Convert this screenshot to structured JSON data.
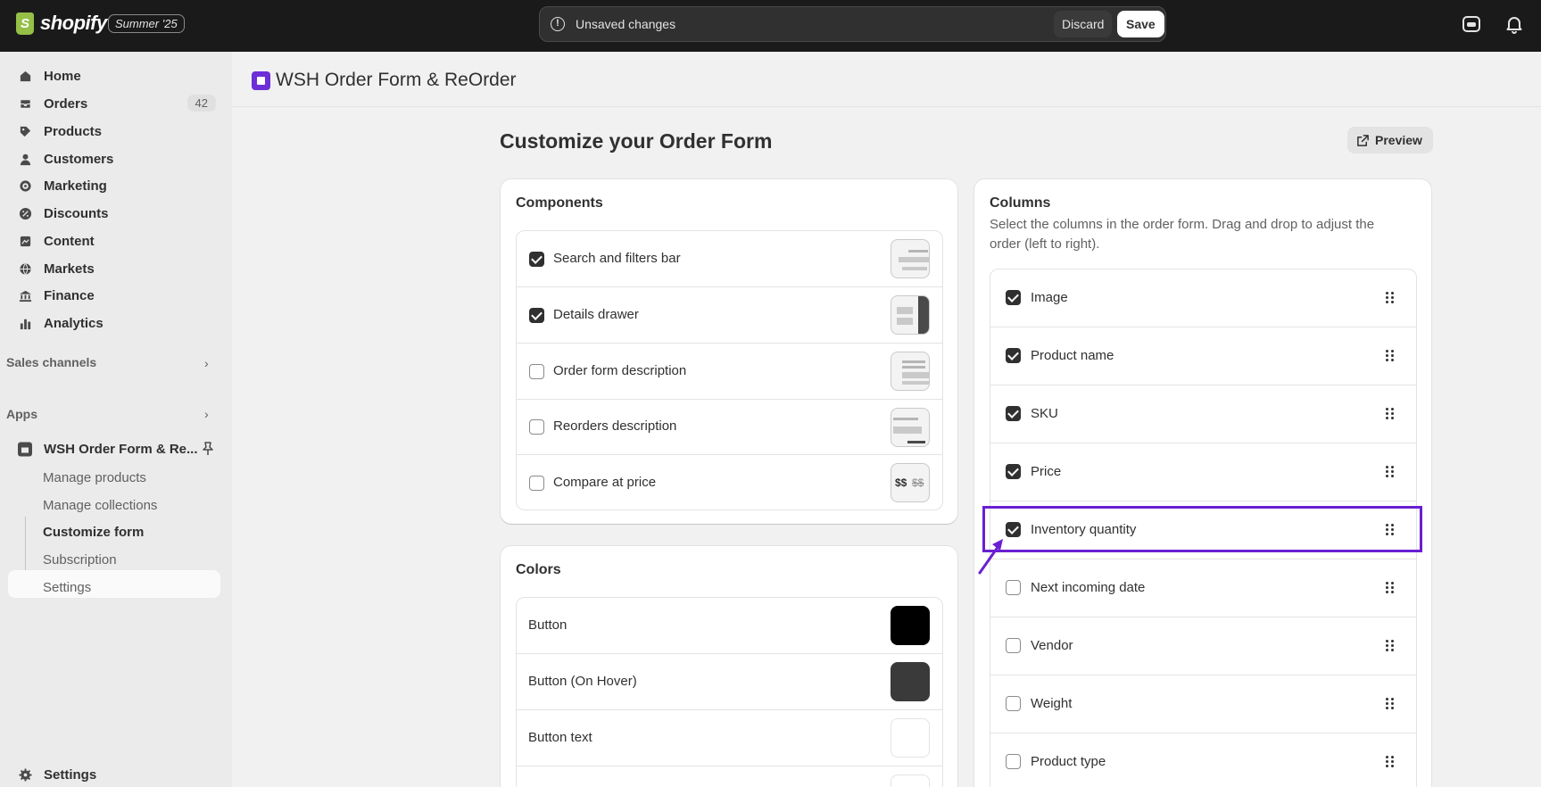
{
  "topbar": {
    "brand": "shopify",
    "edition": "Summer '25",
    "unsaved_message": "Unsaved changes",
    "discard_label": "Discard",
    "save_label": "Save"
  },
  "sidebar": {
    "items": [
      {
        "label": "Home",
        "icon": "home-icon"
      },
      {
        "label": "Orders",
        "icon": "orders-icon",
        "count": "42"
      },
      {
        "label": "Products",
        "icon": "tag-icon"
      },
      {
        "label": "Customers",
        "icon": "person-icon"
      },
      {
        "label": "Marketing",
        "icon": "target-icon"
      },
      {
        "label": "Discounts",
        "icon": "discount-icon"
      },
      {
        "label": "Content",
        "icon": "content-icon"
      },
      {
        "label": "Markets",
        "icon": "globe-icon"
      },
      {
        "label": "Finance",
        "icon": "bank-icon"
      },
      {
        "label": "Analytics",
        "icon": "chart-icon"
      }
    ],
    "sales_channels": "Sales channels",
    "apps": "Apps",
    "app_name": "WSH Order Form & Re...",
    "app_subitems": [
      "Manage products",
      "Manage collections",
      "Customize form",
      "Subscription",
      "Settings"
    ],
    "settings": "Settings"
  },
  "main": {
    "app_title": "WSH Order Form & ReOrder",
    "page_title": "Customize your Order Form",
    "preview_label": "Preview",
    "components": {
      "title": "Components",
      "items": [
        {
          "label": "Search and filters bar",
          "checked": true
        },
        {
          "label": "Details drawer",
          "checked": true
        },
        {
          "label": "Order form description",
          "checked": false
        },
        {
          "label": "Reorders description",
          "checked": false
        },
        {
          "label": "Compare at price",
          "checked": false
        }
      ],
      "compare_thumb_text": "$$",
      "compare_thumb_strike": "$$"
    },
    "colors": {
      "title": "Colors",
      "items": [
        {
          "label": "Button",
          "color": "#000000"
        },
        {
          "label": "Button (On Hover)",
          "color": "#3a3a3a"
        },
        {
          "label": "Button text",
          "color": "#ffffff"
        }
      ]
    },
    "columns": {
      "title": "Columns",
      "description": "Select the columns in the order form. Drag and drop to adjust the order (left to right).",
      "items": [
        {
          "label": "Image",
          "checked": true
        },
        {
          "label": "Product name",
          "checked": true
        },
        {
          "label": "SKU",
          "checked": true
        },
        {
          "label": "Price",
          "checked": true
        },
        {
          "label": "Inventory quantity",
          "checked": true
        },
        {
          "label": "Next incoming date",
          "checked": false
        },
        {
          "label": "Vendor",
          "checked": false
        },
        {
          "label": "Weight",
          "checked": false
        },
        {
          "label": "Product type",
          "checked": false
        }
      ]
    },
    "highlight_color": "#6a1fd1"
  }
}
